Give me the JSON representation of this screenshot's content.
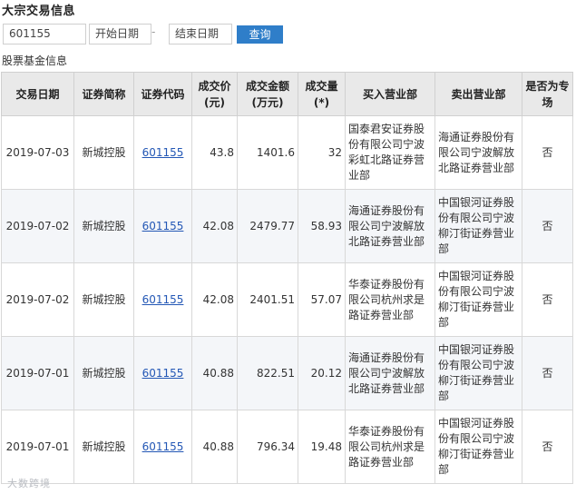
{
  "page": {
    "title": "大宗交易信息",
    "section_title": "股票基金信息",
    "watermark": "大数跨境"
  },
  "search": {
    "code_value": "601155",
    "start_date_placeholder": "开始日期",
    "separator": "-",
    "end_date_placeholder": "结束日期",
    "query_label": "查询"
  },
  "table": {
    "headers": {
      "date": "交易日期",
      "name": "证券简称",
      "code": "证券代码",
      "price": "成交价(元)",
      "amount": "成交金额(万元)",
      "volume": "成交量(*)",
      "buyer": "买入营业部",
      "seller": "卖出营业部",
      "special": "是否为专场"
    },
    "rows": [
      {
        "date": "2019-07-03",
        "name": "新城控股",
        "code": "601155",
        "price": "43.8",
        "amount": "1401.6",
        "volume": "32",
        "buyer": "国泰君安证券股份有限公司宁波彩虹北路证券营业部",
        "seller": "海通证券股份有限公司宁波解放北路证券营业部",
        "special": "否"
      },
      {
        "date": "2019-07-02",
        "name": "新城控股",
        "code": "601155",
        "price": "42.08",
        "amount": "2479.77",
        "volume": "58.93",
        "buyer": "海通证券股份有限公司宁波解放北路证券营业部",
        "seller": "中国银河证券股份有限公司宁波柳汀街证券营业部",
        "special": "否"
      },
      {
        "date": "2019-07-02",
        "name": "新城控股",
        "code": "601155",
        "price": "42.08",
        "amount": "2401.51",
        "volume": "57.07",
        "buyer": "华泰证券股份有限公司杭州求是路证券营业部",
        "seller": "中国银河证券股份有限公司宁波柳汀街证券营业部",
        "special": "否"
      },
      {
        "date": "2019-07-01",
        "name": "新城控股",
        "code": "601155",
        "price": "40.88",
        "amount": "822.51",
        "volume": "20.12",
        "buyer": "海通证券股份有限公司宁波解放北路证券营业部",
        "seller": "中国银河证券股份有限公司宁波柳汀街证券营业部",
        "special": "否"
      },
      {
        "date": "2019-07-01",
        "name": "新城控股",
        "code": "601155",
        "price": "40.88",
        "amount": "796.34",
        "volume": "19.48",
        "buyer": "华泰证券股份有限公司杭州求是路证券营业部",
        "seller": "中国银河证券股份有限公司宁波柳汀街证券营业部",
        "special": "否"
      }
    ]
  }
}
